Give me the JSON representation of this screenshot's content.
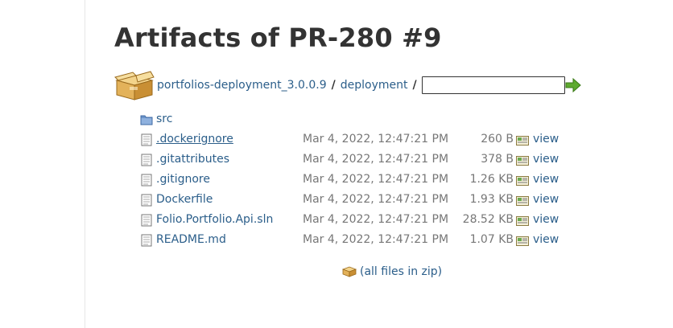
{
  "page": {
    "title": "Artifacts of PR-280 #9"
  },
  "breadcrumb": {
    "items": [
      {
        "label": "portfolios-deployment_3.0.0.9"
      },
      {
        "label": "deployment"
      }
    ],
    "separator": "/",
    "path_input_value": ""
  },
  "listing": {
    "folder": {
      "name": "src"
    },
    "files": [
      {
        "name": ".dockerignore",
        "date": "Mar 4, 2022, 12:47:21 PM",
        "size": "260 B",
        "view": "view"
      },
      {
        "name": ".gitattributes",
        "date": "Mar 4, 2022, 12:47:21 PM",
        "size": "378 B",
        "view": "view"
      },
      {
        "name": ".gitignore",
        "date": "Mar 4, 2022, 12:47:21 PM",
        "size": "1.26 KB",
        "view": "view"
      },
      {
        "name": "Dockerfile",
        "date": "Mar 4, 2022, 12:47:21 PM",
        "size": "1.93 KB",
        "view": "view"
      },
      {
        "name": "Folio.Portfolio.Api.sln",
        "date": "Mar 4, 2022, 12:47:21 PM",
        "size": "28.52 KB",
        "view": "view"
      },
      {
        "name": "README.md",
        "date": "Mar 4, 2022, 12:47:21 PM",
        "size": "1.07 KB",
        "view": "view"
      }
    ]
  },
  "zip": {
    "label": "(all files in zip)"
  },
  "colors": {
    "link": "#2b5e8a",
    "muted": "#777777",
    "text": "#333333"
  },
  "icons": {
    "breadcrumb": "package-icon",
    "go": "go-arrow-icon",
    "folder": "folder-icon",
    "file": "file-icon",
    "view": "view-icon",
    "zip": "zip-icon"
  }
}
